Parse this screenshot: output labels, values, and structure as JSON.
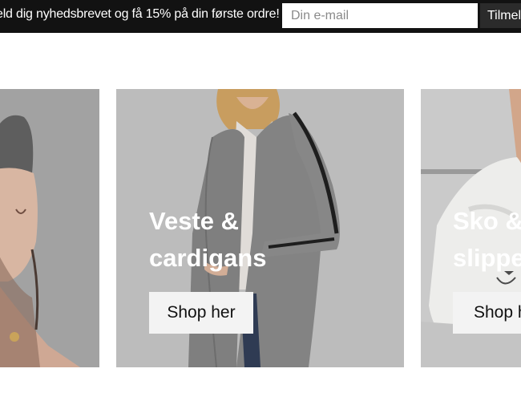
{
  "newsletter": {
    "promo_text": "eld dig nyhedsbrevet og få 15% på din første ordre!",
    "email_placeholder": "Din e-mail",
    "button_label": "Tilmeld"
  },
  "categories": [
    {
      "title": "",
      "button_label": ""
    },
    {
      "title": "Veste &\ncardigans",
      "button_label": "Shop her"
    },
    {
      "title": "Sko &\nslippers",
      "button_label": "Shop her"
    }
  ],
  "colors": {
    "topbar_background": "#121212",
    "button_background": "#f3f3f3",
    "title_text": "#ffffff"
  }
}
